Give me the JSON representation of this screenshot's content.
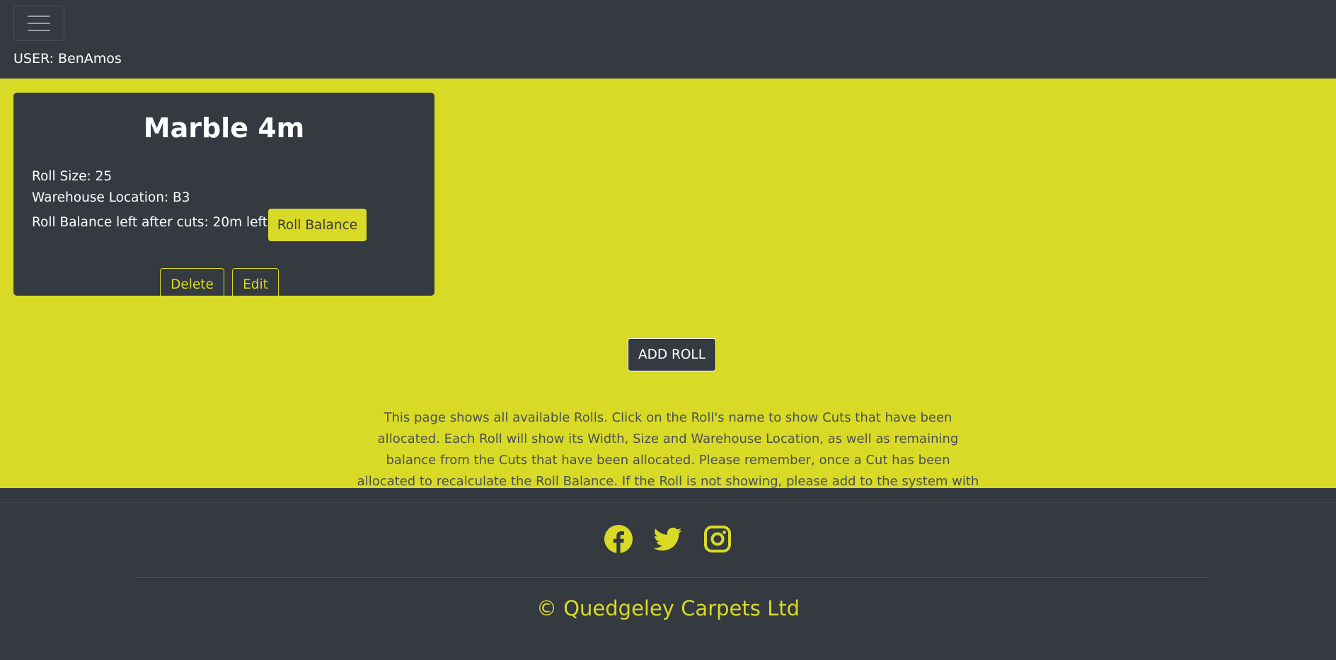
{
  "header": {
    "user_label": "USER: BenAmos"
  },
  "roll": {
    "title": "Marble 4m",
    "size_line": "Roll Size: 25",
    "location_line": "Warehouse Location: B3",
    "balance_line": "Roll Balance left after cuts: 20m left",
    "balance_button": "Roll Balance",
    "delete_button": "Delete",
    "edit_button": "Edit"
  },
  "actions": {
    "add_roll_button": "ADD ROLL"
  },
  "help_text": "This page shows all available Rolls. Click on the Roll's name to show Cuts that have been allocated. Each Roll will show its Width, Size and Warehouse Location, as well as remaining balance from the Cuts that have been allocated. Please remember, once a Cut has been allocated to recalculate the Roll Balance. If the Roll is not showing, please add to the system with the 'ADD ROLL' button.",
  "footer": {
    "social_icons": [
      "facebook-icon",
      "twitter-icon",
      "instagram-icon"
    ],
    "copyright": "© Quedgeley Carpets Ltd"
  },
  "colors": {
    "accent": "#d9da25",
    "dark": "#343a40",
    "text_muted": "#495057"
  }
}
